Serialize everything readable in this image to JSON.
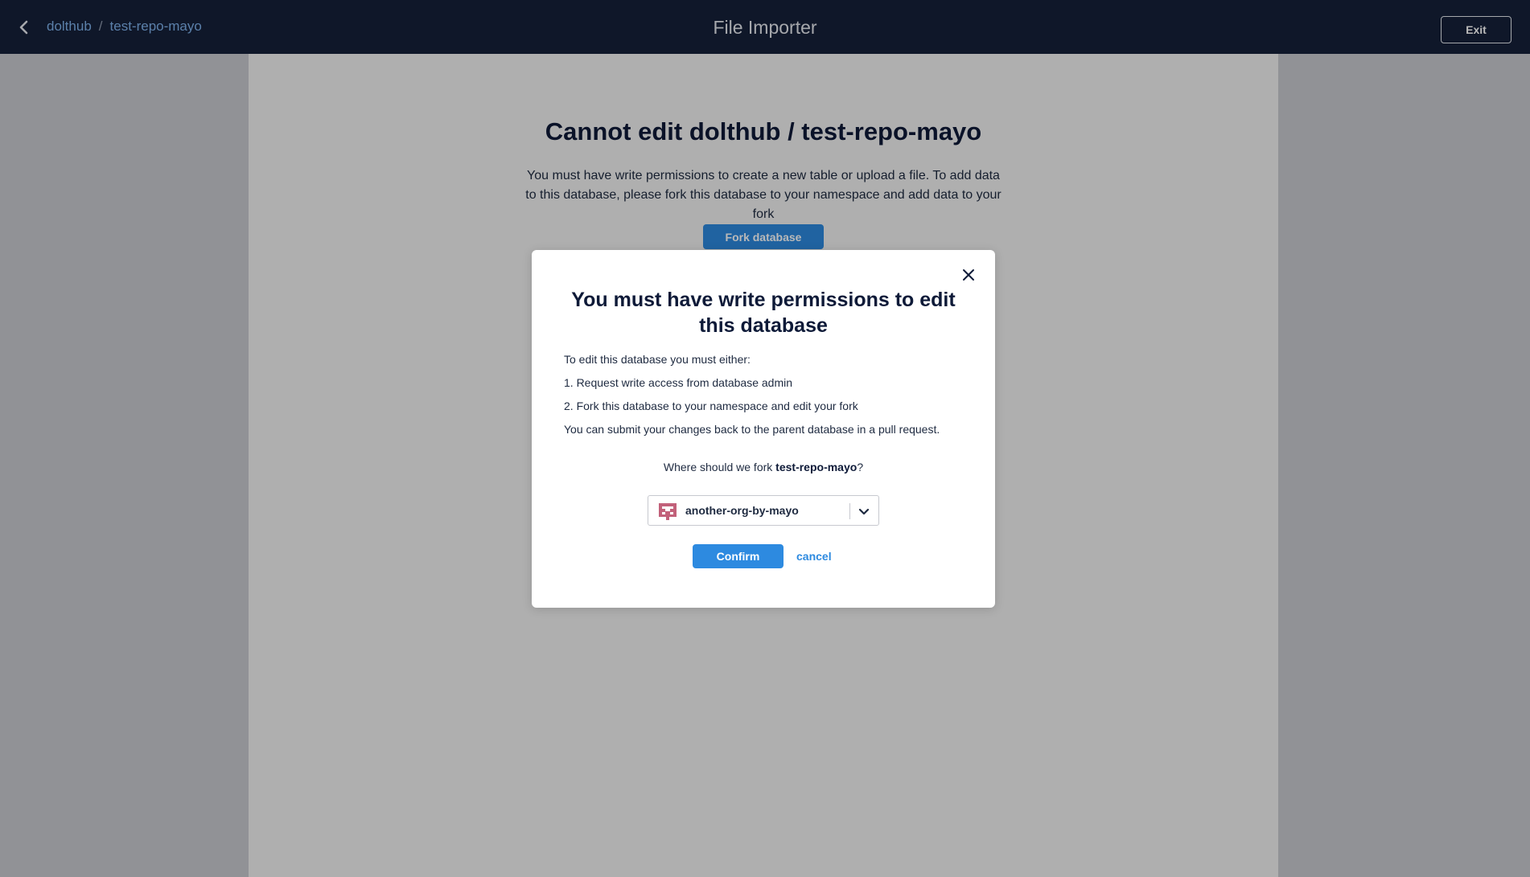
{
  "header": {
    "breadcrumb": [
      "dolthub",
      "test-repo-mayo"
    ],
    "breadcrumb_separator": "/",
    "title": "File Importer",
    "exit_label": "Exit",
    "back_icon": "chevron-left-icon"
  },
  "main": {
    "heading": "Cannot edit dolthub / test-repo-mayo",
    "description": "You must have write permissions to create a new table or upload a file. To add data to this database, please fork this database to your namespace and add data to your fork",
    "fork_button_label": "Fork database"
  },
  "modal": {
    "title": "You must have write permissions to edit this database",
    "intro": "To edit this database you must either:",
    "option_1": "1. Request write access from database admin",
    "option_2": "2. Fork this database to your namespace and edit your fork",
    "note": "You can submit your changes back to the parent database in a pull request.",
    "question_prefix": "Where should we fork ",
    "question_repo": "test-repo-mayo",
    "question_suffix": "?",
    "owner_select_value": "another-org-by-mayo",
    "confirm_label": "Confirm",
    "cancel_label": "cancel",
    "close_icon": "close-icon",
    "chevron_icon": "chevron-down-icon"
  },
  "colors": {
    "header_bg": "#16213a",
    "accent_blue": "#2d8ae0",
    "link_blue": "#7fb2ec",
    "heading_text": "#0e1a38",
    "avatar_color": "#c2617a"
  }
}
